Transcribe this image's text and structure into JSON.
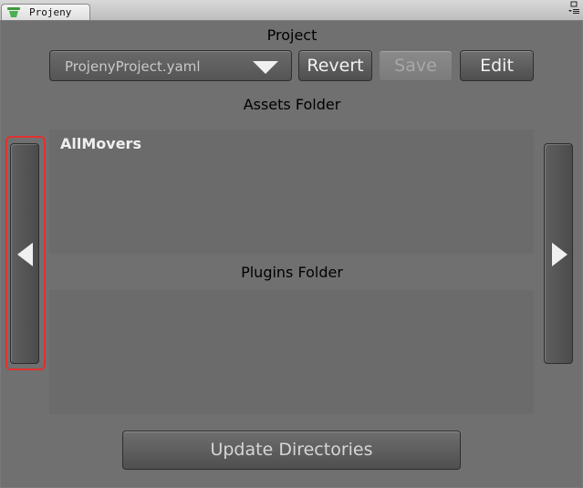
{
  "tab": {
    "title": "Projeny",
    "icon": "projeny-cup-icon"
  },
  "window_controls": {
    "icon": "tab-menu-icon"
  },
  "project": {
    "label": "Project",
    "selected_file": "ProjenyProject.yaml",
    "dropdown_icon": "chevron-down-icon",
    "revert_label": "Revert",
    "save_label": "Save",
    "edit_label": "Edit",
    "save_enabled": false
  },
  "assets": {
    "label": "Assets Folder",
    "items": [
      "AllMovers"
    ]
  },
  "plugins": {
    "label": "Plugins Folder",
    "items": []
  },
  "nav": {
    "left_icon": "arrow-left-icon",
    "right_icon": "arrow-right-icon"
  },
  "update_label": "Update Directories",
  "highlight_color": "#e23030"
}
